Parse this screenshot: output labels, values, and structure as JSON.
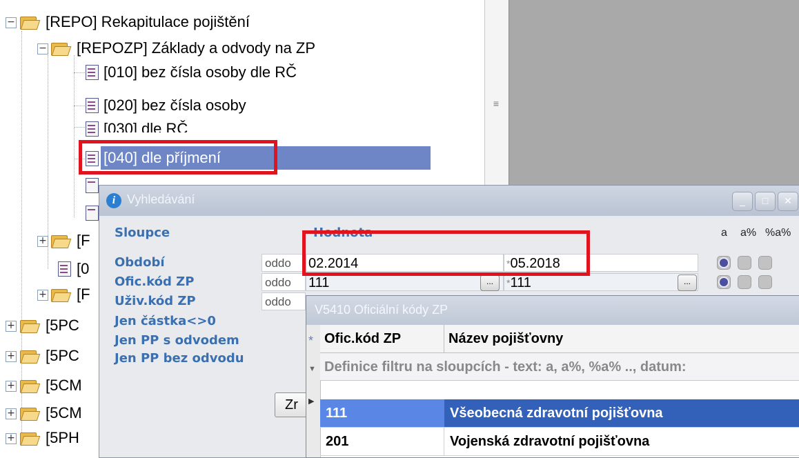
{
  "tree": {
    "items": [
      {
        "label": "[REPO]  Rekapitulace pojištění"
      },
      {
        "label": "[REPOZP]  Základy a odvody na ZP"
      },
      {
        "label": "[010] bez čísla osoby dle RČ"
      },
      {
        "label": "[020] bez čísla osoby"
      },
      {
        "label": "[030] dle RČ"
      },
      {
        "label": "[040] dle příjmení"
      },
      {
        "label": "[F"
      },
      {
        "label": "[0"
      },
      {
        "label": "[F"
      },
      {
        "label": "[5PC"
      },
      {
        "label": "[5PC"
      },
      {
        "label": "[5CM"
      },
      {
        "label": "[5CM"
      },
      {
        "label": "[5PH"
      }
    ],
    "scroll_grip": "≡"
  },
  "search_window": {
    "title": "Vyhledávání",
    "col_columns": "Sloupce",
    "col_value": "Hodnota",
    "col_a": "a",
    "col_a_pct": "a%",
    "col_pct_a_pct": "%a%",
    "rows": [
      {
        "label": "Období",
        "mode": "oddo",
        "from": "02.2014",
        "to": "05.2018"
      },
      {
        "label": "Ofic.kód ZP",
        "mode": "oddo",
        "from": "111",
        "to": "111"
      },
      {
        "label": "Uživ.kód ZP",
        "mode": "oddo"
      }
    ],
    "flags": [
      "Jen částka<>0",
      "Jen PP s odvodem",
      "Jen PP bez odvodu"
    ],
    "button_label": "Zr",
    "ellipsis": "...",
    "star": "*"
  },
  "lookup_window": {
    "title": "V5410 Oficiální kódy ZP",
    "columns": [
      "Ofic.kód ZP",
      "Název pojišťovny"
    ],
    "header_marker": "*",
    "filter_hint": "Definice filtru na sloupcích - text: a, a%, %a% .., datum:",
    "rows": [
      {
        "code": "111",
        "name": "Všeobecná zdravotní pojišťovna"
      },
      {
        "code": "201",
        "name": "Vojenská zdravotní pojišťovna"
      }
    ]
  },
  "colors": {
    "highlight_red": "#e0141e",
    "selected_tree": "#6f86c6",
    "selected_grid": "#3360b8",
    "label_blue": "#3a6fb0"
  }
}
